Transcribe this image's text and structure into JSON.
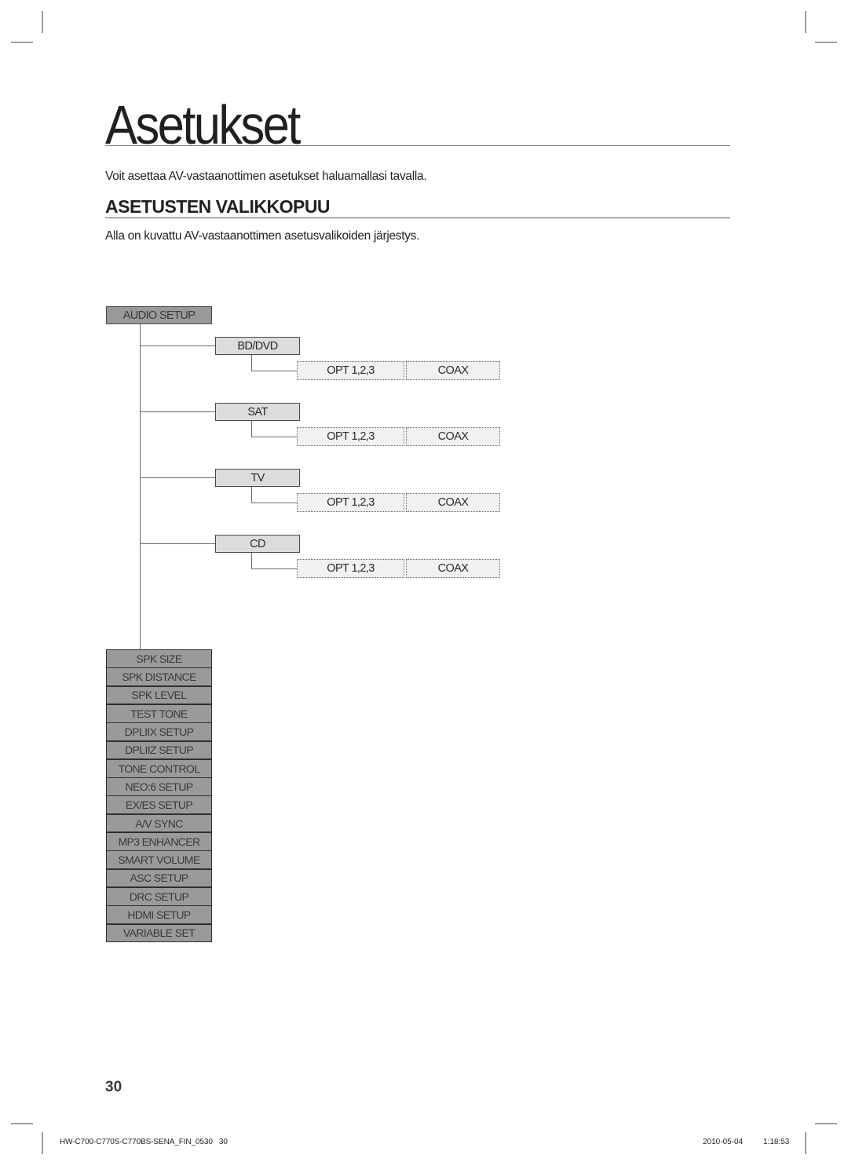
{
  "page": {
    "title": "Asetukset",
    "intro": "Voit asettaa AV-vastaanottimen asetukset haluamallasi tavalla.",
    "section_heading": "ASETUSTEN VALIKKOPUU",
    "section_description": "Alla on kuvattu AV-vastaanottimen asetusvalikoiden järjestys."
  },
  "menu_tree": {
    "root": "AUDIO SETUP",
    "sources": [
      {
        "label": "BD/DVD",
        "options": [
          "OPT 1,2,3",
          "COAX"
        ]
      },
      {
        "label": "SAT",
        "options": [
          "OPT 1,2,3",
          "COAX"
        ]
      },
      {
        "label": "TV",
        "options": [
          "OPT 1,2,3",
          "COAX"
        ]
      },
      {
        "label": "CD",
        "options": [
          "OPT 1,2,3",
          "COAX"
        ]
      }
    ],
    "settings": [
      "SPK SIZE",
      "SPK DISTANCE",
      "SPK LEVEL",
      "TEST TONE",
      "DPLIIX SETUP",
      "DPLIIZ SETUP",
      "TONE CONTROL",
      "NEO:6 SETUP",
      "EX/ES SETUP",
      "A/V SYNC",
      "MP3 ENHANCER",
      "SMART VOLUME",
      "ASC SETUP",
      "DRC SETUP",
      "HDMI SETUP",
      "VARIABLE SET"
    ]
  },
  "footer": {
    "page_number": "30",
    "file_label": "HW-C700-C770S-C770BS-SENA_FIN_0530   30",
    "date": "2010-05-04",
    "time": "1:18:53"
  }
}
